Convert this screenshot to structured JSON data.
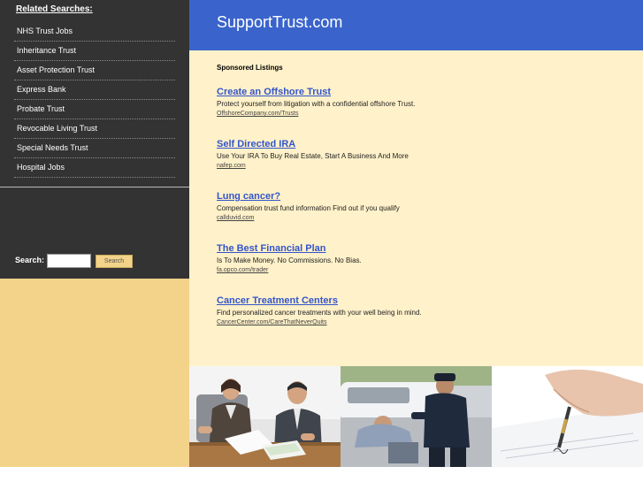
{
  "sidebar": {
    "related_title": "Related Searches:",
    "items": [
      {
        "label": "NHS Trust Jobs"
      },
      {
        "label": "Inheritance Trust"
      },
      {
        "label": "Asset Protection Trust"
      },
      {
        "label": "Express Bank"
      },
      {
        "label": "Probate Trust"
      },
      {
        "label": "Revocable Living Trust"
      },
      {
        "label": "Special Needs Trust"
      },
      {
        "label": "Hospital Jobs"
      }
    ],
    "search_label": "Search:",
    "search_value": "",
    "search_button": "Search"
  },
  "header": {
    "site_title": "SupportTrust.com"
  },
  "main": {
    "sponsored_label": "Sponsored Listings",
    "listings": [
      {
        "title": "Create an Offshore Trust",
        "desc": "Protect yourself from litigation with a confidential offshore Trust.",
        "url": "OffshoreCompany.com/Trusts"
      },
      {
        "title": "Self Directed IRA",
        "desc": "Use Your IRA To Buy Real Estate, Start A Business And More",
        "url": "nafep.com"
      },
      {
        "title": "Lung cancer?",
        "desc": "Compensation trust fund information Find out if you qualify",
        "url": "callduvid.com"
      },
      {
        "title": "The Best Financial Plan",
        "desc": "Is To Make Money. No Commissions. No Bias.",
        "url": "fa.opco.com/trader"
      },
      {
        "title": "Cancer Treatment Centers",
        "desc": "Find personalized cancer treatments with your well being in mind.",
        "url": "CancerCenter.com/CareThatNeverQuits"
      }
    ]
  },
  "colors": {
    "sidebar_bg": "#333333",
    "header_bg": "#3a64cc",
    "content_bg": "#fff1c9",
    "sidebar_bottom_bg": "#f3d38a",
    "link": "#3355cc"
  }
}
